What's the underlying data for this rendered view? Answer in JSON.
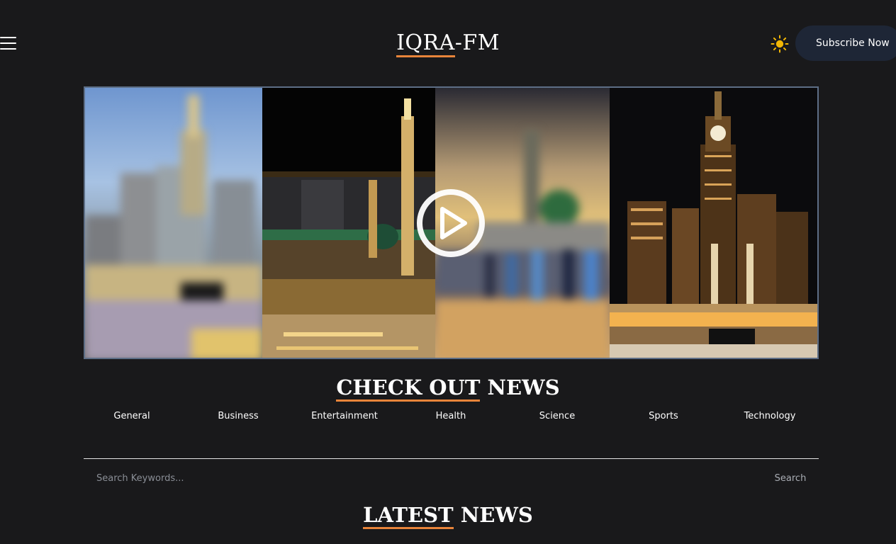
{
  "header": {
    "logo_part1": "IQRA",
    "logo_part2": "-FM",
    "subscribe_label": "Subscribe Now",
    "icons": {
      "menu": "hamburger-icon",
      "theme": "sun-icon"
    },
    "accent_color": "#e8843a",
    "theme_icon_color": "#f2b705"
  },
  "hero": {
    "icons": {
      "play": "play-icon"
    }
  },
  "news": {
    "title_part1": "CHECK OUT",
    "title_part2": " NEWS",
    "categories": [
      "General",
      "Business",
      "Entertainment",
      "Health",
      "Science",
      "Sports",
      "Technology"
    ]
  },
  "search": {
    "placeholder": "Search Keywords...",
    "button_label": "Search"
  },
  "latest": {
    "title_part1": "LATEST",
    "title_part2": " NEWS"
  }
}
